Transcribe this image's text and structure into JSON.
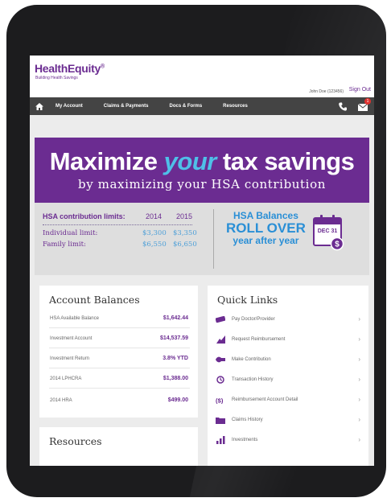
{
  "header": {
    "logo_text": "HealthEquity",
    "logo_tm": "®",
    "tagline": "Building Health Savings",
    "user": "John Doe (123456)",
    "signout": "Sign Out"
  },
  "nav": {
    "items": [
      "My Account",
      "Claims & Payments",
      "Docs & Forms",
      "Resources"
    ],
    "mail_badge": "1"
  },
  "hero": {
    "line1_a": "Maximize ",
    "line1_accent": "your",
    "line1_b": " tax savings",
    "line2": "by maximizing your HSA contribution"
  },
  "limits": {
    "title": "HSA contribution limits:",
    "years": [
      "2014",
      "2015"
    ],
    "individual_label": "Individual limit:",
    "individual_values": [
      "$3,300",
      "$3,350"
    ],
    "family_label": "Family limit:",
    "family_values": [
      "$6,550",
      "$6,650"
    ],
    "rollover_l1": "HSA Balances",
    "rollover_l2": "ROLL OVER",
    "rollover_l3": "year after year",
    "calendar_label": "DEC 31"
  },
  "balances": {
    "title": "Account Balances",
    "rows": [
      {
        "label": "HSA Available Balance",
        "value": "$1,642.44"
      },
      {
        "label": "Investment Account",
        "value": "$14,537.59"
      },
      {
        "label": "Investment Return",
        "value": "3.8% YTD"
      },
      {
        "label": "2014 LPHCRA",
        "value": "$1,388.00"
      },
      {
        "label": "2014 HRA",
        "value": "$499.00"
      }
    ]
  },
  "resources": {
    "title": "Resources"
  },
  "quicklinks": {
    "title": "Quick Links",
    "items": [
      {
        "label": "Pay Doctor/Provider",
        "icon": "pay-icon"
      },
      {
        "label": "Request Reimbursement",
        "icon": "reimbursement-icon"
      },
      {
        "label": "Make Contribution",
        "icon": "contribution-icon"
      },
      {
        "label": "Transaction History",
        "icon": "history-icon"
      },
      {
        "label": "Reimbursement Account Detail",
        "icon": "account-detail-icon"
      },
      {
        "label": "Claims History",
        "icon": "folder-icon"
      },
      {
        "label": "Investments",
        "icon": "investments-icon"
      }
    ]
  },
  "colors": {
    "brand_purple": "#6b2c91",
    "accent_blue": "#4fc0e8",
    "nav_gray": "#444444"
  }
}
